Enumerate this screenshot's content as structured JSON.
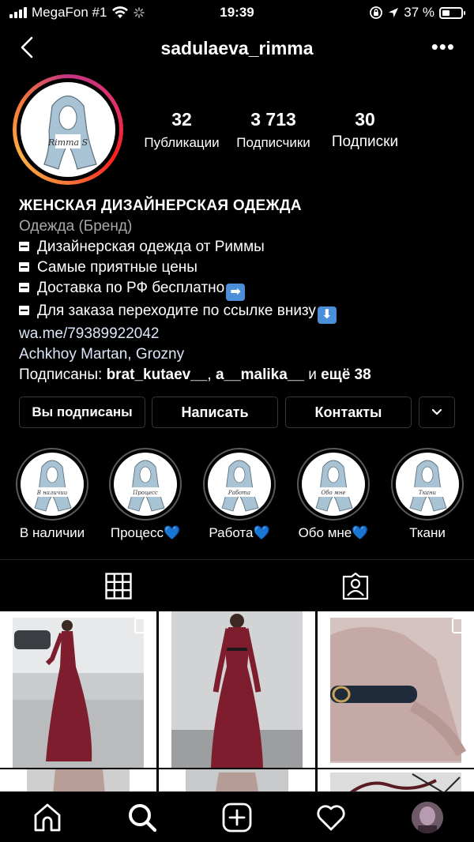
{
  "status_bar": {
    "carrier": "MegaFon #1",
    "time": "19:39",
    "battery": "37 %"
  },
  "nav": {
    "username": "sadulaeva_rimma",
    "more_label": "•••"
  },
  "profile": {
    "avatar_text": "Rimma S",
    "stats": [
      {
        "value": "32",
        "label": "Публикации"
      },
      {
        "value": "3 713",
        "label": "Подписчики"
      },
      {
        "value": "30",
        "label": "Подписки"
      }
    ],
    "bio": {
      "name": "ЖЕНСКАЯ ДИЗАЙНЕРСКАЯ ОДЕЖДА",
      "category": "Одежда (Бренд)",
      "lines": [
        "Дизайнерская одежда от Риммы",
        "Самые приятные цены",
        "Доставка по РФ бесплатно",
        "Для заказа переходите по ссылке внизу"
      ],
      "emoji_right": "➡",
      "emoji_down": "⬇",
      "link": "wa.me/79389922042",
      "location": "Achkhoy Martan, Grozny",
      "followed_prefix": "Подписаны: ",
      "followed_user1": "brat_kutaev__",
      "followed_sep": ", ",
      "followed_user2": "a__malika__",
      "followed_and": " и ",
      "followed_more": "ещё 38"
    }
  },
  "buttons": {
    "following": "Вы подписаны",
    "message": "Написать",
    "contacts": "Контакты"
  },
  "highlights": [
    {
      "label": "В наличии",
      "heart": "",
      "pic_text": "В наличии"
    },
    {
      "label": "Процесс",
      "heart": "💙",
      "pic_text": "Процесс"
    },
    {
      "label": "Работа",
      "heart": "💙",
      "pic_text": "Работа"
    },
    {
      "label": "Обо мне",
      "heart": "💙",
      "pic_text": "Обо мне"
    },
    {
      "label": "Ткани",
      "heart": "",
      "pic_text": "Ткани"
    }
  ],
  "colors": {
    "background": "#000000",
    "secondary_text": "#a8a8a8",
    "border": "#363636",
    "dress": "#7d1d2e",
    "scarf": "#a8c4d4",
    "heart": "#4a90e8"
  }
}
